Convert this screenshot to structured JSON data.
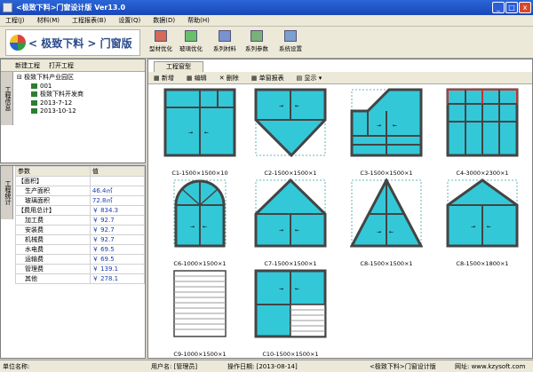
{
  "window": {
    "title": "<极致下料>门窗设计版   Ver13.0",
    "min": "_",
    "max": "□",
    "close": "x"
  },
  "menu": [
    "工程(J)",
    "材料(M)",
    "工程报表(B)",
    "设置(Q)",
    "数据(D)",
    "帮助(H)"
  ],
  "logo": "< 极致下料 > 门窗版",
  "toolbar": [
    {
      "label": "型材优化",
      "icon": "profile-optimize-icon",
      "color": "#c04040"
    },
    {
      "label": "玻璃优化",
      "icon": "glass-optimize-icon",
      "color": "#3a9a3a"
    },
    {
      "label": "系列材料",
      "icon": "series-material-icon",
      "color": "#4a6ab0"
    },
    {
      "label": "系列参数",
      "icon": "series-param-icon",
      "color": "#4a8a4a"
    },
    {
      "label": "系统设置",
      "icon": "system-settings-icon",
      "color": "#4a7ab0"
    }
  ],
  "left": {
    "new_project": "新建工程",
    "open_project": "打开工程",
    "tab_project_list": "工程信息",
    "tab_project_stats": "工程统计",
    "tree": [
      "极致下料产业园区",
      "001",
      "极致下料开发商",
      "2013-7-12",
      "2013-10-12"
    ],
    "props_header": [
      "参数",
      "值"
    ],
    "props": [
      {
        "name": "【面积】",
        "value": ""
      },
      {
        "name": "生产面积",
        "value": "46.4㎡"
      },
      {
        "name": "玻璃面积",
        "value": "72.8㎡"
      },
      {
        "name": "【费用总计】",
        "value": "￥ 834.3"
      },
      {
        "name": "加工费",
        "value": "￥ 92.7"
      },
      {
        "name": "安装费",
        "value": "￥ 92.7"
      },
      {
        "name": "机械费",
        "value": "￥ 92.7"
      },
      {
        "name": "水电费",
        "value": "￥ 69.5"
      },
      {
        "name": "运输费",
        "value": "￥ 69.5"
      },
      {
        "name": "管理费",
        "value": "￥ 139.1"
      },
      {
        "name": "其他",
        "value": "￥ 278.1"
      }
    ]
  },
  "main": {
    "tab": "工程窗型",
    "actions": [
      "新增",
      "编辑",
      "删除",
      "单窗报表",
      "显示"
    ],
    "cards": [
      "C1-1500×1500×10",
      "C2-1500×1500×1",
      "C3-1500×1500×1",
      "C4-3000×2300×1",
      "C6-1000×1500×1",
      "C7-1500×1500×1",
      "C8-1500×1500×1",
      "C8-1500×1800×1",
      "C9-1000×1500×1",
      "C10-1500×1500×1"
    ]
  },
  "status": {
    "unit_label": "单位名称:",
    "user": "用户名: [管理员]",
    "date": "操作日期: [2013-08-14]",
    "product": "<极致下料>门窗设计版",
    "website": "网址: www.kzysoft.com"
  },
  "colors": {
    "glass": "#33c8d8",
    "frame": "#444444",
    "accent": "#2a66d8"
  }
}
